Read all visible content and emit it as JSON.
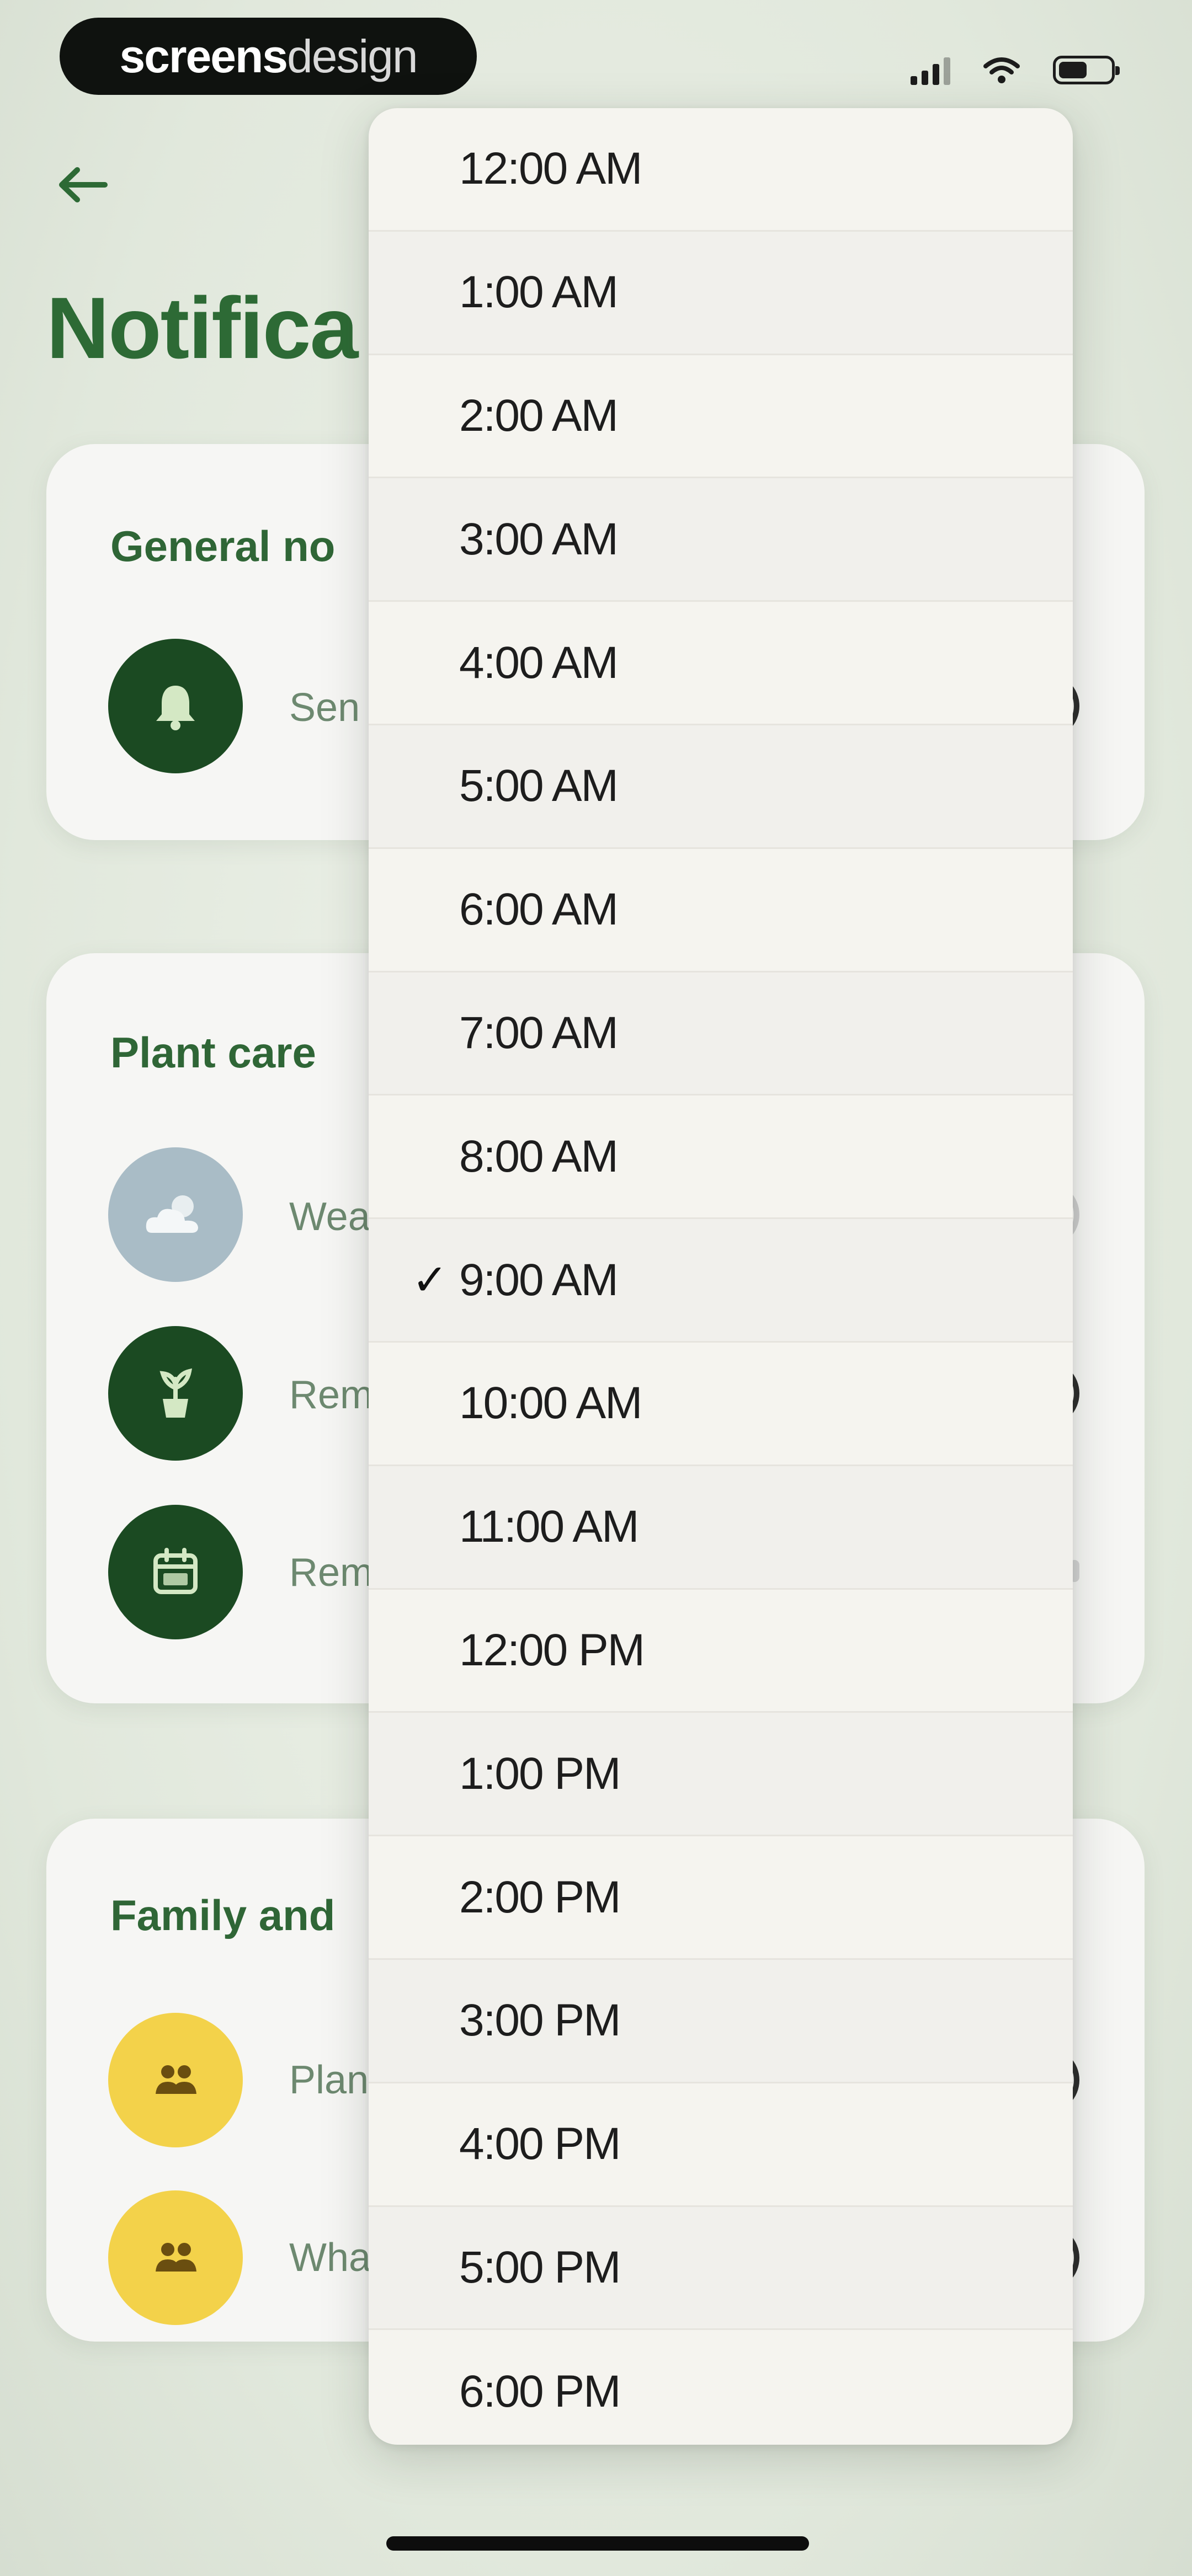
{
  "status_bar": {
    "brand_left": "screens",
    "brand_right": "design",
    "icons": [
      "cellular-signal-icon",
      "wifi-icon",
      "battery-icon"
    ]
  },
  "header": {
    "back_icon": "arrow-left-icon",
    "title": "Notifica"
  },
  "cards": [
    {
      "title": "General no",
      "rows": [
        {
          "icon": "bell-icon",
          "label": "Sen",
          "control": "toggle"
        }
      ]
    },
    {
      "title": "Plant care",
      "rows": [
        {
          "icon": "weather-cloud-icon",
          "label": "Wea",
          "control": "toggle"
        },
        {
          "icon": "plant-pot-icon",
          "label": "Rem",
          "control": "toggle"
        },
        {
          "icon": "calendar-icon",
          "label": "Rem",
          "control": "select"
        }
      ]
    },
    {
      "title": "Family and",
      "rows": [
        {
          "icon": "people-icon",
          "label": "Plan",
          "control": "toggle"
        },
        {
          "icon": "people-icon",
          "label": "Wha",
          "control": "toggle"
        }
      ]
    }
  ],
  "time_menu": {
    "check_glyph": "✓",
    "selected": "9:00 AM",
    "options": [
      "12:00 AM",
      "1:00 AM",
      "2:00 AM",
      "3:00 AM",
      "4:00 AM",
      "5:00 AM",
      "6:00 AM",
      "7:00 AM",
      "8:00 AM",
      "9:00 AM",
      "10:00 AM",
      "11:00 AM",
      "12:00 PM",
      "1:00 PM",
      "2:00 PM",
      "3:00 PM",
      "4:00 PM",
      "5:00 PM",
      "6:00 PM"
    ]
  },
  "colors": {
    "title_green": "#2d6a35",
    "icon_dark_green": "#1b4a22",
    "icon_grey_blue": "#a9bcc6",
    "icon_yellow": "#f3d24a",
    "menu_background": "#f5f4ef"
  }
}
